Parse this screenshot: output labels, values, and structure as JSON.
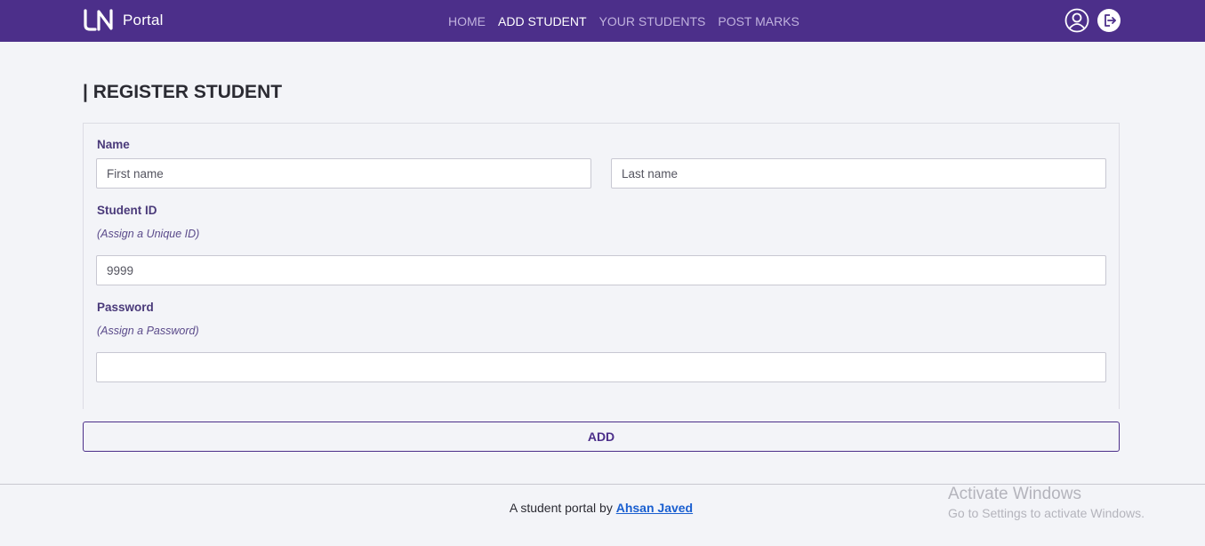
{
  "brand": {
    "logo_text": "LN",
    "name": "Portal"
  },
  "nav": {
    "links": [
      {
        "label": "HOME"
      },
      {
        "label": "ADD STUDENT"
      },
      {
        "label": "YOUR STUDENTS"
      },
      {
        "label": "POST MARKS"
      }
    ],
    "active_index": 1,
    "icons": [
      "user-profile-icon",
      "logout-icon"
    ]
  },
  "page": {
    "title": "| REGISTER STUDENT"
  },
  "form": {
    "name_label": "Name",
    "first_name_placeholder": "First name",
    "first_name_value": "",
    "last_name_placeholder": "Last name",
    "last_name_value": "",
    "student_id_label": "Student ID",
    "student_id_hint": "(Assign a Unique ID)",
    "student_id_placeholder": "9999",
    "student_id_value": "",
    "password_label": "Password",
    "password_hint": "(Assign a Password)",
    "password_value": "",
    "submit_label": "ADD"
  },
  "footer": {
    "text": "A student portal by",
    "author": "Ahsan Javed"
  },
  "watermark": {
    "title": "Activate Windows",
    "subtitle": "Go to Settings to activate Windows."
  },
  "colors": {
    "navbar": "#4c2f8a",
    "nav_link": "#c0b2de",
    "accent": "#4c2f8a",
    "page_bg": "#f3f4f8",
    "footer_link": "#1a5fd0"
  }
}
